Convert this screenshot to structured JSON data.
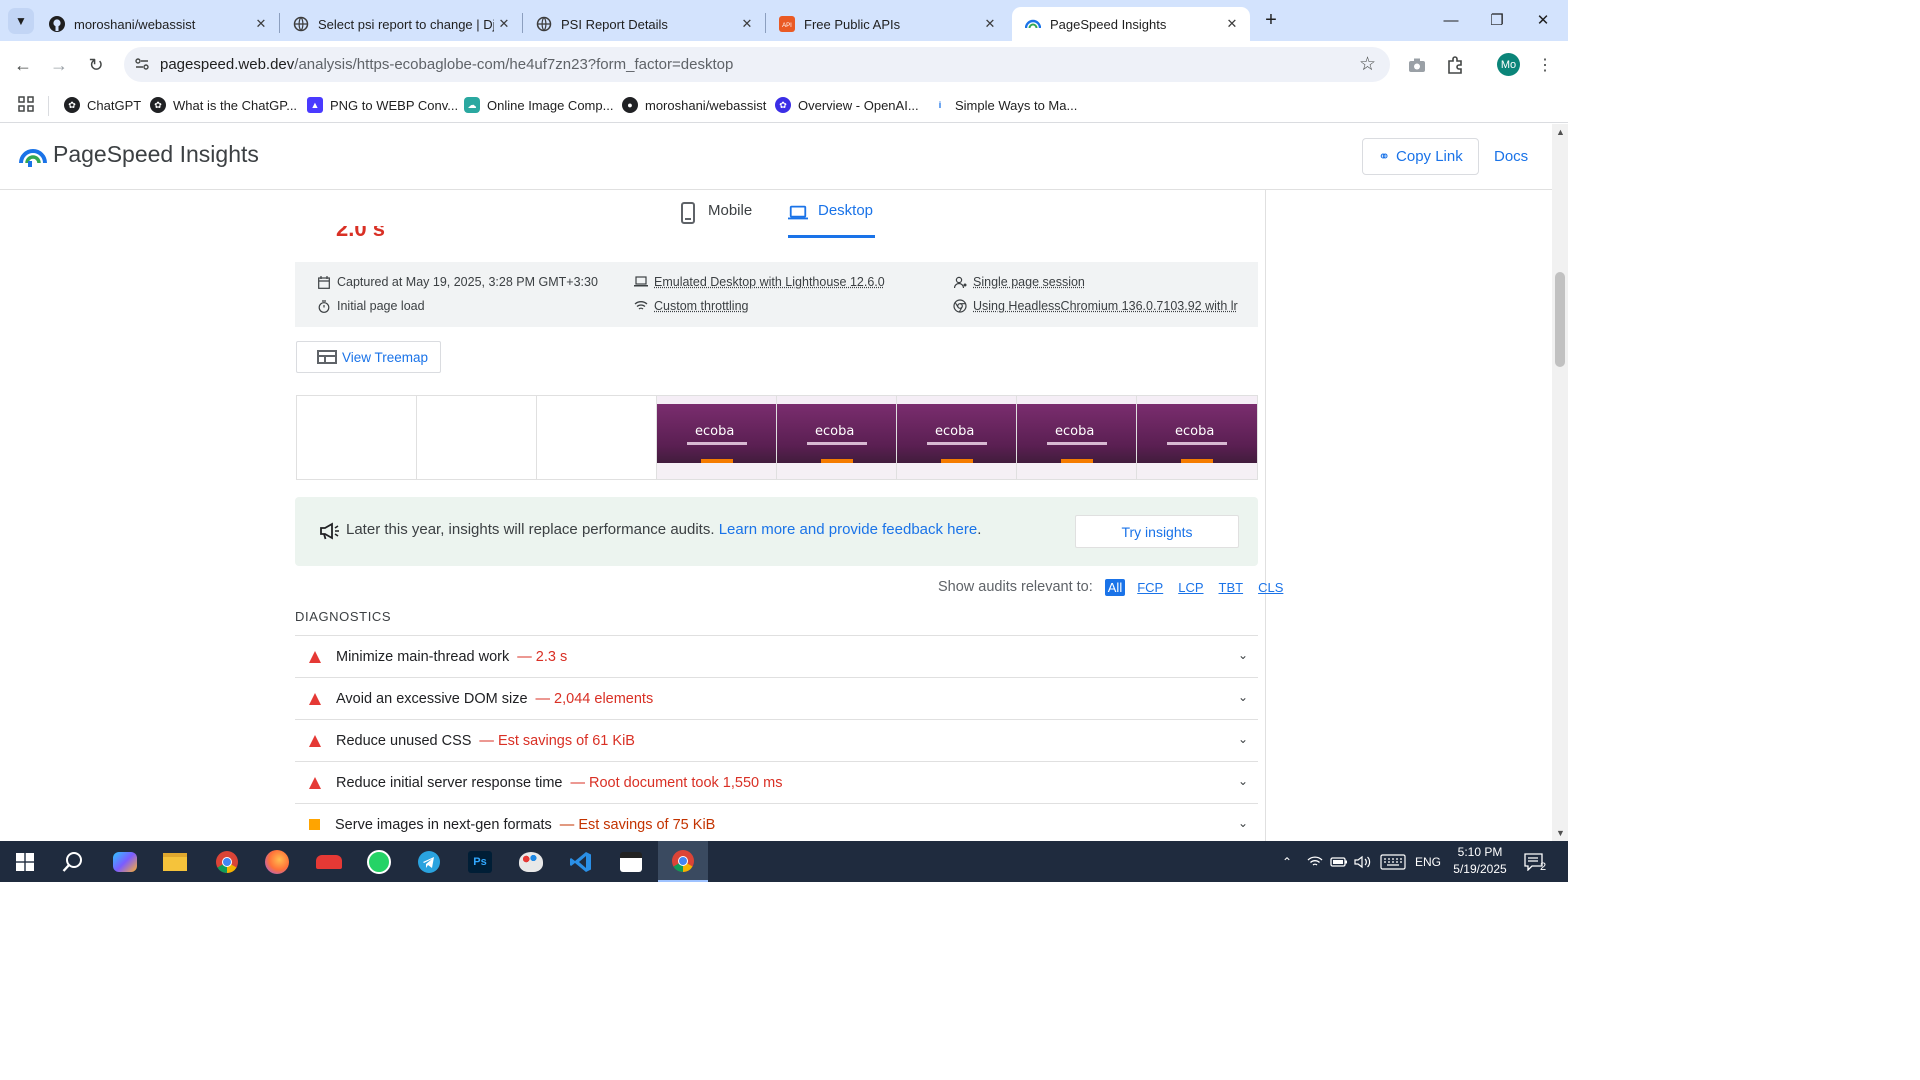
{
  "browser": {
    "tabs": [
      {
        "title": "moroshani/webassist",
        "favicon": "github-icon"
      },
      {
        "title": "Select psi report to change | Dj",
        "favicon": "globe-icon"
      },
      {
        "title": "PSI Report Details",
        "favicon": "globe-icon"
      },
      {
        "title": "Free Public APIs",
        "favicon": "api-icon"
      },
      {
        "title": "PageSpeed Insights",
        "favicon": "pagespeed-icon"
      }
    ],
    "url_host": "pagespeed.web.dev",
    "url_path": "/analysis/https-ecobaglobe-com/he4uf7zn23?form_factor=desktop",
    "profile_initials": "Mo"
  },
  "bookmarks": [
    {
      "label": "ChatGPT",
      "color": "#202124"
    },
    {
      "label": "What is the ChatGP...",
      "color": "#202124"
    },
    {
      "label": "PNG to WEBP Conv...",
      "color": "#4a3aff"
    },
    {
      "label": "Online Image Comp...",
      "color": "#2aa8a0"
    },
    {
      "label": "moroshani/webassist",
      "color": "#202124"
    },
    {
      "label": "Overview - OpenAI...",
      "color": "#3b2ee6"
    },
    {
      "label": "Simple Ways to Ma...",
      "color": "#1a73e8"
    }
  ],
  "header": {
    "title": "PageSpeed Insights",
    "copy_link": "Copy Link",
    "docs": "Docs"
  },
  "device_tabs": {
    "mobile": "Mobile",
    "desktop": "Desktop",
    "active": "desktop"
  },
  "meta": {
    "captured": "Captured at May 19, 2025, 3:28 PM GMT+3:30",
    "page_load": "Initial page load",
    "emulated": "Emulated Desktop with Lighthouse 12.6.0",
    "throttling": "Custom throttling",
    "session": "Single page session",
    "browser": "Using HeadlessChromium 136.0.7103.92 with lr"
  },
  "treemap_button": "View Treemap",
  "filmstrip": {
    "brand": "ecoba",
    "frames_loaded": [
      false,
      false,
      false,
      true,
      true,
      true,
      true,
      true
    ]
  },
  "notice": {
    "text": "Later this year, insights will replace performance audits.",
    "link": "Learn more and provide feedback here",
    "period": ".",
    "button": "Try insights"
  },
  "filters": {
    "label": "Show audits relevant to:",
    "options": [
      "All",
      "FCP",
      "LCP",
      "TBT",
      "CLS"
    ],
    "active": "All"
  },
  "diagnostics": {
    "heading": "DIAGNOSTICS",
    "audits": [
      {
        "title": "Minimize main-thread work",
        "detail": "— 2.3 s",
        "severity": "fail"
      },
      {
        "title": "Avoid an excessive DOM size",
        "detail": "— 2,044 elements",
        "severity": "fail"
      },
      {
        "title": "Reduce unused CSS",
        "detail": "— Est savings of 61 KiB",
        "severity": "fail"
      },
      {
        "title": "Reduce initial server response time",
        "detail": "— Root document took 1,550 ms",
        "severity": "fail"
      },
      {
        "title": "Serve images in next-gen formats",
        "detail": "— Est savings of 75 KiB",
        "severity": "average"
      }
    ]
  },
  "colors": {
    "accent": "#1a73e8",
    "fail": "#e53935",
    "average": "#ffa400"
  },
  "taskbar": {
    "language": "ENG",
    "time": "5:10 PM",
    "date": "5/19/2025",
    "notifications": "2"
  }
}
